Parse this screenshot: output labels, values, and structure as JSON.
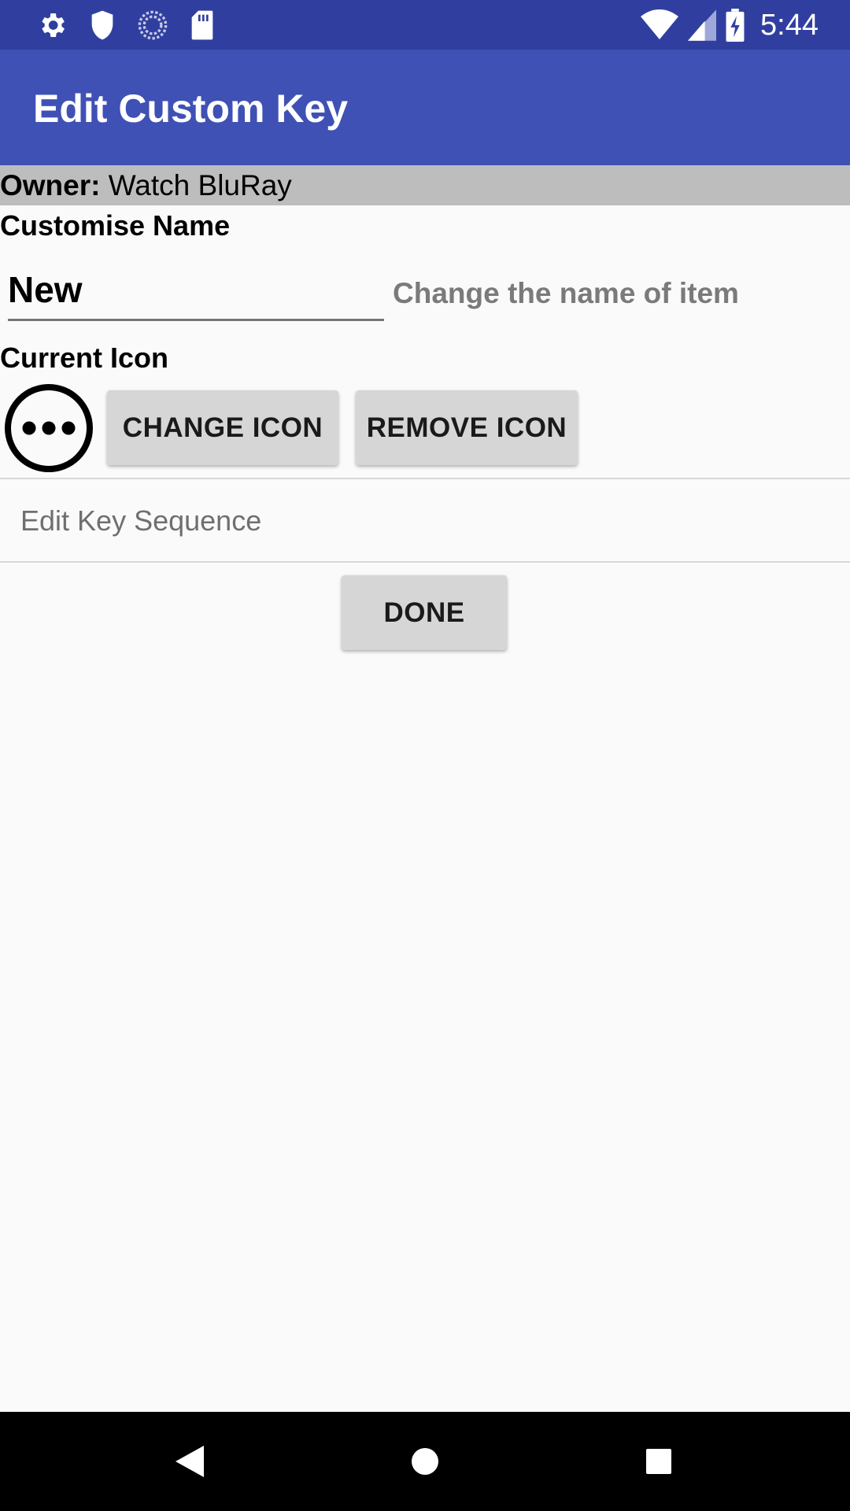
{
  "status_bar": {
    "time": "5:44",
    "left_icons": [
      "settings-icon",
      "shield-icon",
      "sync-icon",
      "sd-card-icon"
    ],
    "right_icons": [
      "wifi-icon",
      "signal-icon",
      "battery-charging-icon"
    ]
  },
  "app_bar": {
    "title": "Edit Custom Key"
  },
  "owner": {
    "label": "Owner:",
    "value": "Watch BluRay"
  },
  "name_section": {
    "label": "Customise Name",
    "input_value": "New",
    "hint": "Change the name of item"
  },
  "icon_section": {
    "label": "Current Icon",
    "current_icon": "more-horizontal-circle-icon",
    "change_button": "CHANGE ICON",
    "remove_button": "REMOVE ICON"
  },
  "key_sequence": {
    "placeholder": "Edit Key Sequence"
  },
  "done_button": "DONE",
  "nav_bar": {
    "icons": [
      "back-icon",
      "home-icon",
      "recents-icon"
    ]
  },
  "colors": {
    "status_bar": "#303f9f",
    "app_bar": "#3f51b5",
    "owner_bg": "#bdbdbd",
    "button_bg": "#d6d6d6"
  }
}
